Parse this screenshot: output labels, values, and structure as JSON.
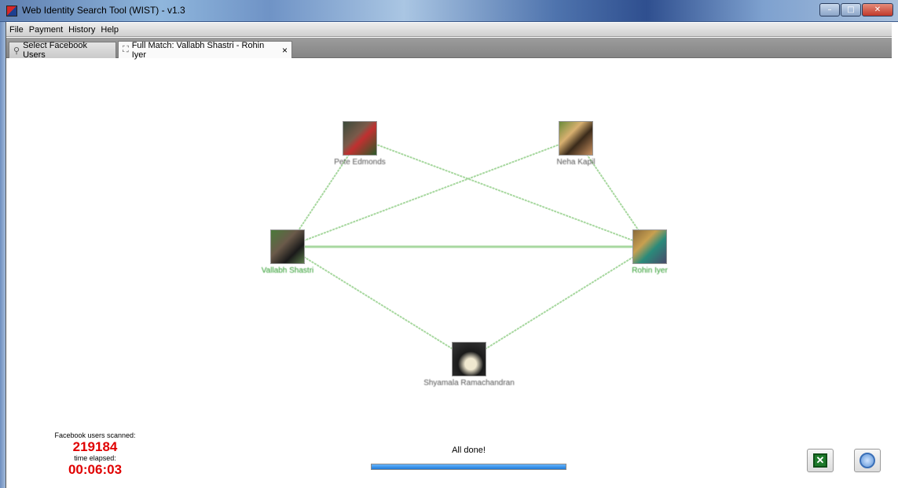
{
  "window": {
    "title": "Web Identity Search Tool (WIST) - v1.3",
    "controls": [
      "minimize",
      "maximize",
      "close"
    ]
  },
  "menu": {
    "items": [
      "File",
      "Payment",
      "History",
      "Help"
    ]
  },
  "tabs": [
    {
      "label": "Select Facebook Users",
      "icon": "user-search-icon",
      "active": false
    },
    {
      "label": "Full Match: Vallabh Shastri - Rohin Iyer",
      "icon": "graph-icon",
      "active": true,
      "close": "×"
    }
  ],
  "graph": {
    "nodes": [
      {
        "id": "top-left",
        "label": "Pete Edmonds",
        "highlight": false
      },
      {
        "id": "top-right",
        "label": "Neha Kapil",
        "highlight": false
      },
      {
        "id": "left",
        "label": "Vallabh Shastri",
        "highlight": true
      },
      {
        "id": "right",
        "label": "Rohin Iyer",
        "highlight": true
      },
      {
        "id": "bottom",
        "label": "Shyamala Ramachandran",
        "highlight": false
      }
    ],
    "edges": [
      [
        "top-left",
        "right"
      ],
      [
        "top-left",
        "left"
      ],
      [
        "top-right",
        "left"
      ],
      [
        "top-right",
        "right"
      ],
      [
        "left",
        "right"
      ],
      [
        "left",
        "bottom"
      ],
      [
        "right",
        "bottom"
      ]
    ],
    "edge_color": "#a8d8a0"
  },
  "stats": {
    "scanned_label": "Facebook users scanned:",
    "scanned_value": "219184",
    "elapsed_label": "time elapsed:",
    "elapsed_value": "00:06:03",
    "value_color": "#e00000"
  },
  "status": {
    "text": "All done!",
    "progress": 1.0
  },
  "toolbar": {
    "excel_icon": "excel-export-icon",
    "export_icon": "web-export-icon"
  }
}
